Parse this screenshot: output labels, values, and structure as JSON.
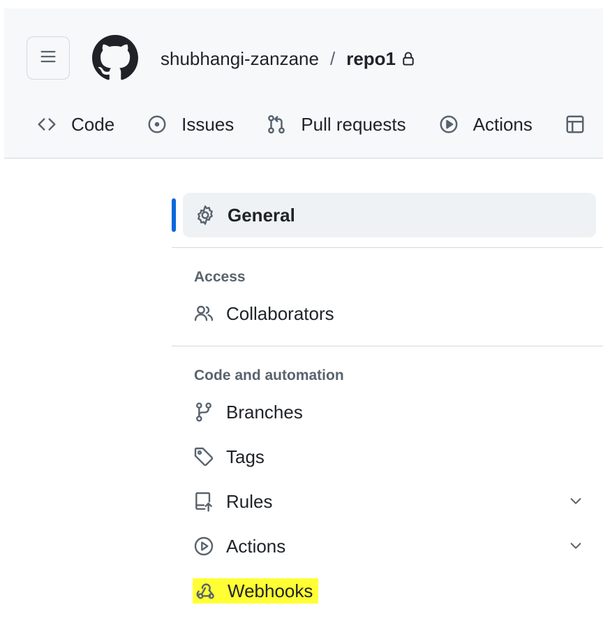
{
  "header": {
    "owner": "shubhangi-zanzane",
    "separator": "/",
    "repo": "repo1",
    "icons": {
      "menu": "hamburger-icon",
      "logo": "github-logo-icon",
      "lock": "lock-icon"
    }
  },
  "repo_nav": {
    "tabs": [
      {
        "label": "Code",
        "icon": "code-icon"
      },
      {
        "label": "Issues",
        "icon": "issue-opened-icon"
      },
      {
        "label": "Pull requests",
        "icon": "git-pull-request-icon"
      },
      {
        "label": "Actions",
        "icon": "play-icon"
      },
      {
        "label": "",
        "icon": "table-icon"
      }
    ]
  },
  "sidebar": {
    "general": {
      "label": "General",
      "icon": "gear-icon",
      "active": true
    },
    "access": {
      "heading": "Access",
      "items": [
        {
          "label": "Collaborators",
          "icon": "people-icon"
        }
      ]
    },
    "code_automation": {
      "heading": "Code and automation",
      "items": [
        {
          "label": "Branches",
          "icon": "git-branch-icon"
        },
        {
          "label": "Tags",
          "icon": "tag-icon"
        },
        {
          "label": "Rules",
          "icon": "repo-push-icon",
          "expandable": true
        },
        {
          "label": "Actions",
          "icon": "play-icon",
          "expandable": true
        },
        {
          "label": "Webhooks",
          "icon": "webhook-icon",
          "highlighted": true
        }
      ]
    }
  },
  "colors": {
    "accent": "#0969da",
    "highlight": "#ffff33",
    "header_bg": "#f6f8fa",
    "text": "#1f2328",
    "muted": "#59636e",
    "border": "#d1d9e0"
  }
}
